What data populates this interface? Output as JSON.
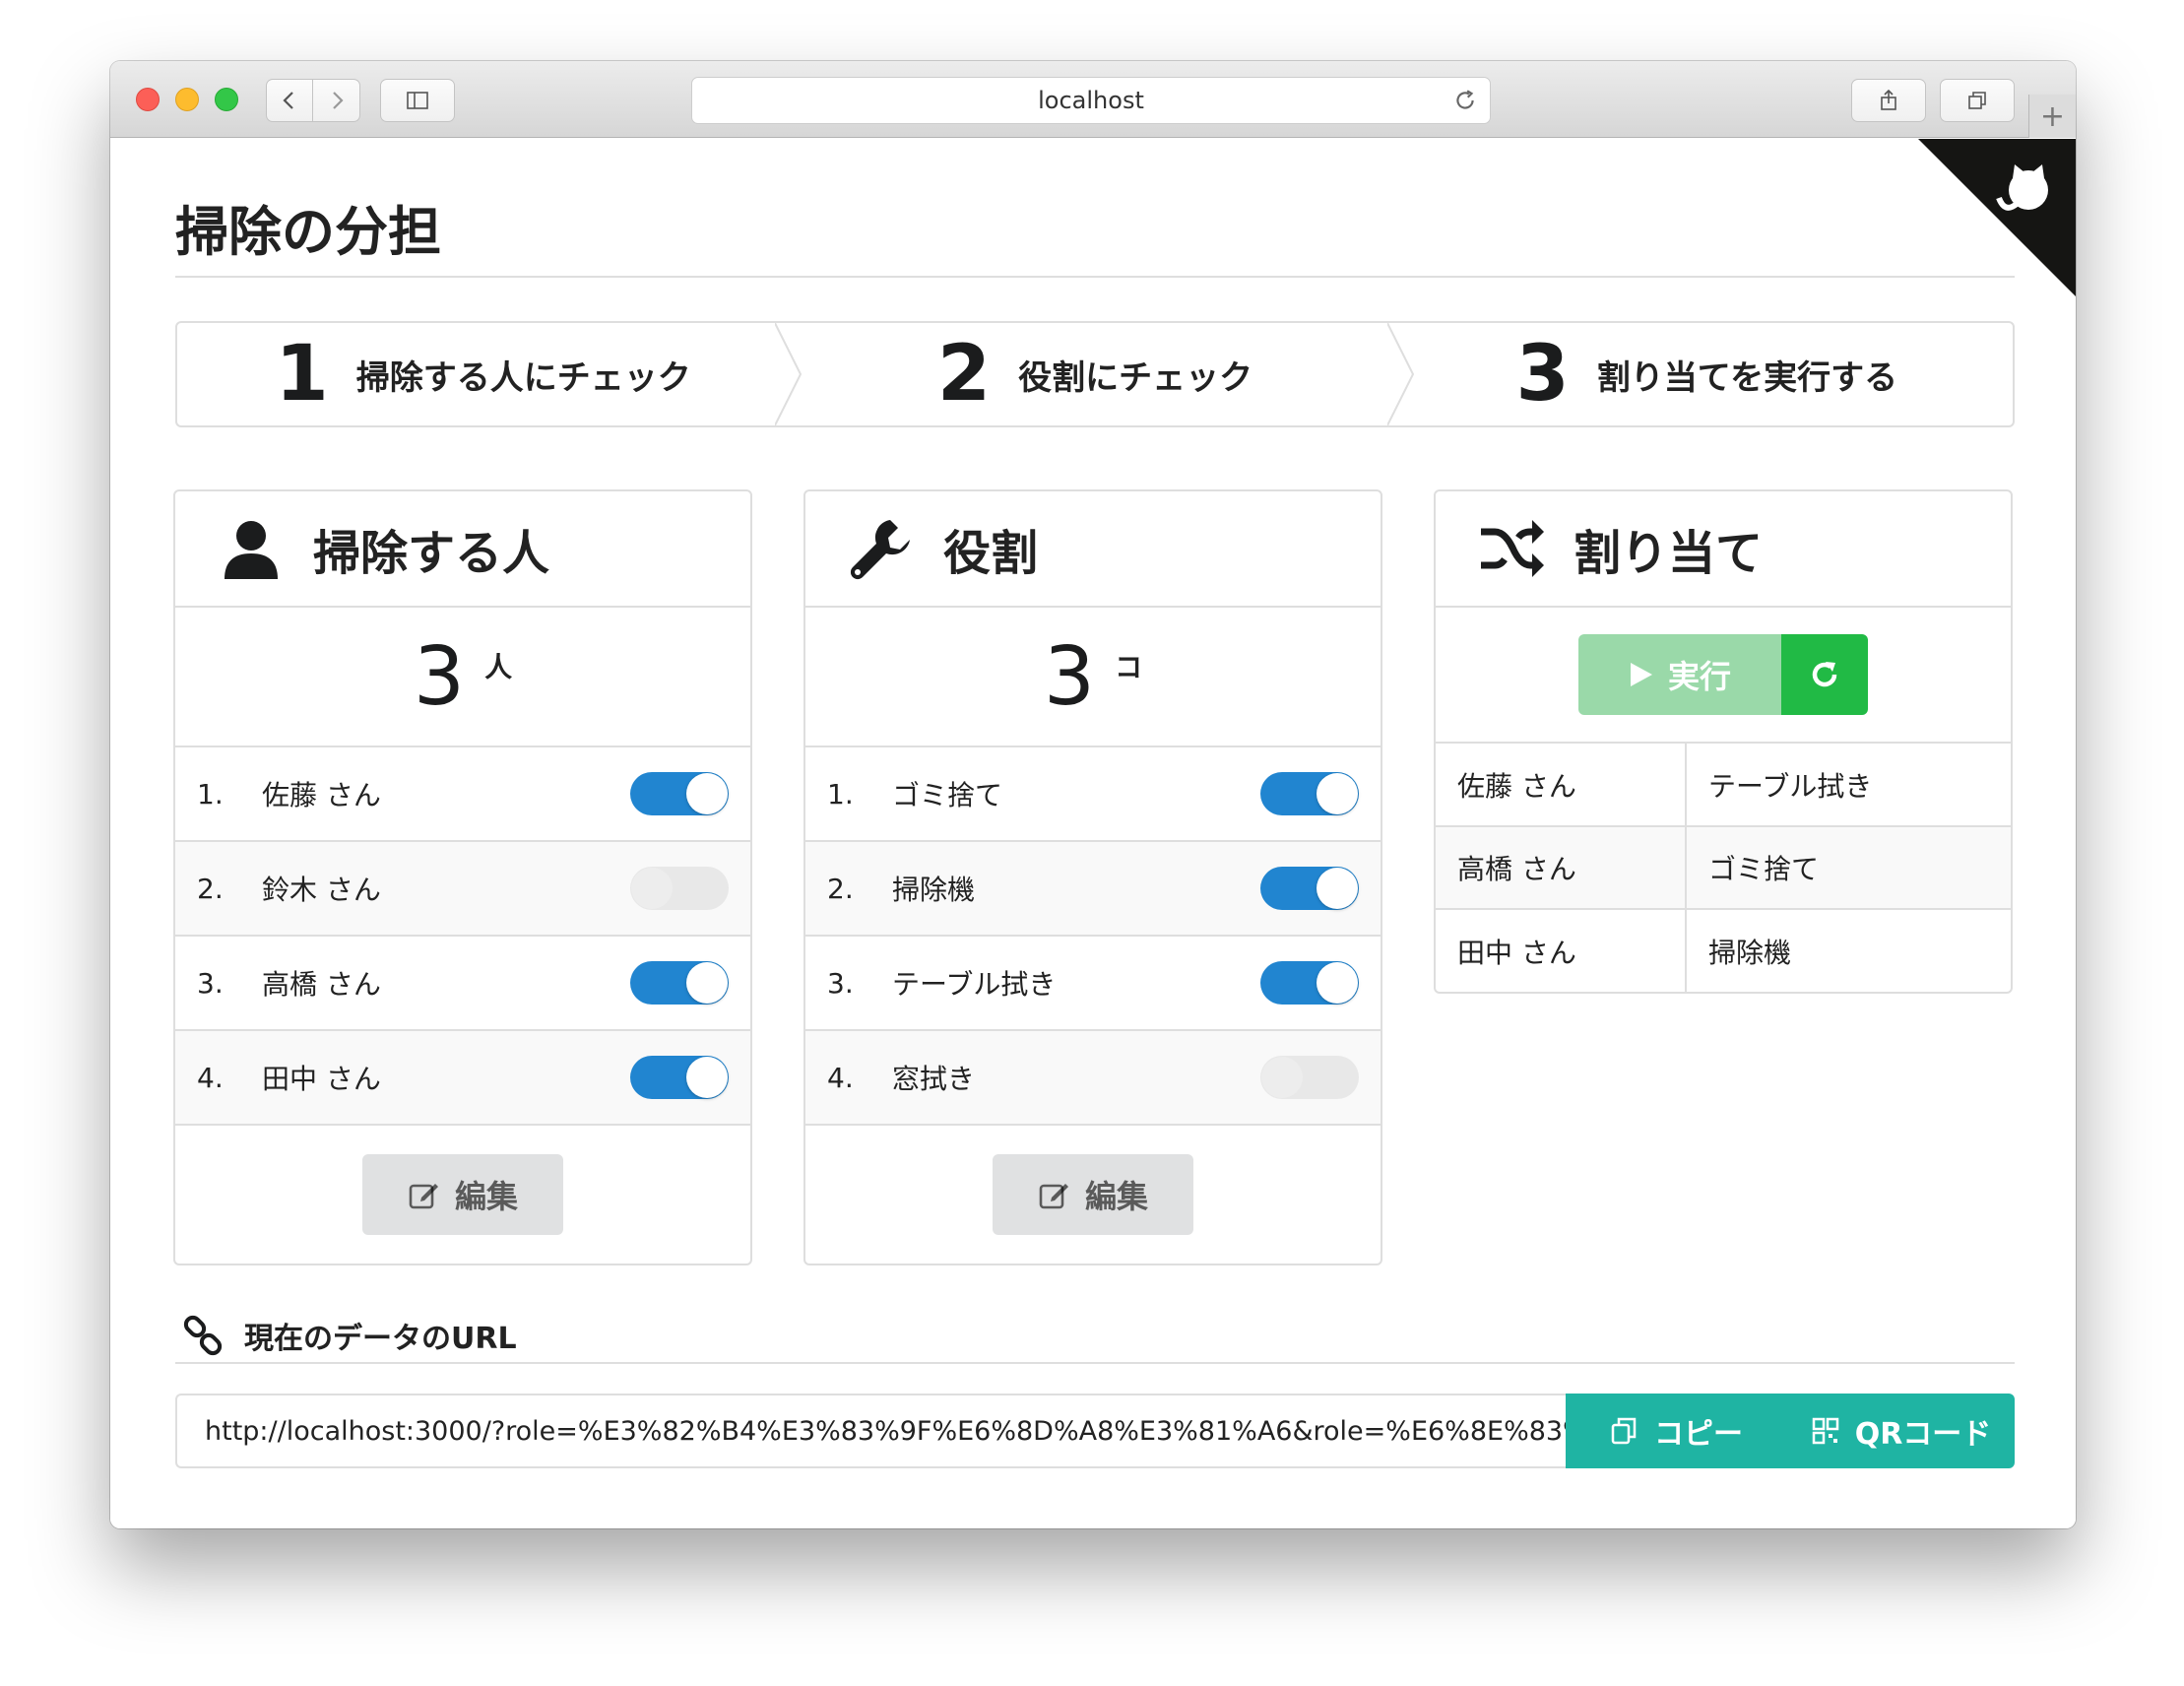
{
  "browser": {
    "url": "localhost"
  },
  "page": {
    "title": "掃除の分担"
  },
  "steps": [
    {
      "num": "1",
      "label": "掃除する人にチェック"
    },
    {
      "num": "2",
      "label": "役割にチェック"
    },
    {
      "num": "3",
      "label": "割り当てを実行する"
    }
  ],
  "people": {
    "title": "掃除する人",
    "count": "3",
    "unit": "人",
    "items": [
      {
        "idx": "1.",
        "name": "佐藤 さん",
        "checked": true
      },
      {
        "idx": "2.",
        "name": "鈴木 さん",
        "checked": false
      },
      {
        "idx": "3.",
        "name": "高橋 さん",
        "checked": true
      },
      {
        "idx": "4.",
        "name": "田中 さん",
        "checked": true
      }
    ],
    "edit_label": "編集"
  },
  "roles": {
    "title": "役割",
    "count": "3",
    "unit": "コ",
    "items": [
      {
        "idx": "1.",
        "name": "ゴミ捨て",
        "checked": true
      },
      {
        "idx": "2.",
        "name": "掃除機",
        "checked": true
      },
      {
        "idx": "3.",
        "name": "テーブル拭き",
        "checked": true
      },
      {
        "idx": "4.",
        "name": "窓拭き",
        "checked": false
      }
    ],
    "edit_label": "編集"
  },
  "assign": {
    "title": "割り当て",
    "run_label": "実行",
    "results": [
      {
        "person": "佐藤 さん",
        "role": "テーブル拭き"
      },
      {
        "person": "高橋 さん",
        "role": "ゴミ捨て"
      },
      {
        "person": "田中 さん",
        "role": "掃除機"
      }
    ]
  },
  "url_section": {
    "label": "現在のデータのURL",
    "value": "http://localhost:3000/?role=%E3%82%B4%E3%83%9F%E6%8D%A8%E3%81%A6&role=%E6%8E%83%E9%9",
    "copy_label": "コピー",
    "qr_label": "QRコード"
  },
  "colors": {
    "toggle_on": "#2185d0",
    "run_button": "#9ad9a9",
    "reset_button": "#21ba45",
    "url_buttons": "#1fb4a3"
  }
}
